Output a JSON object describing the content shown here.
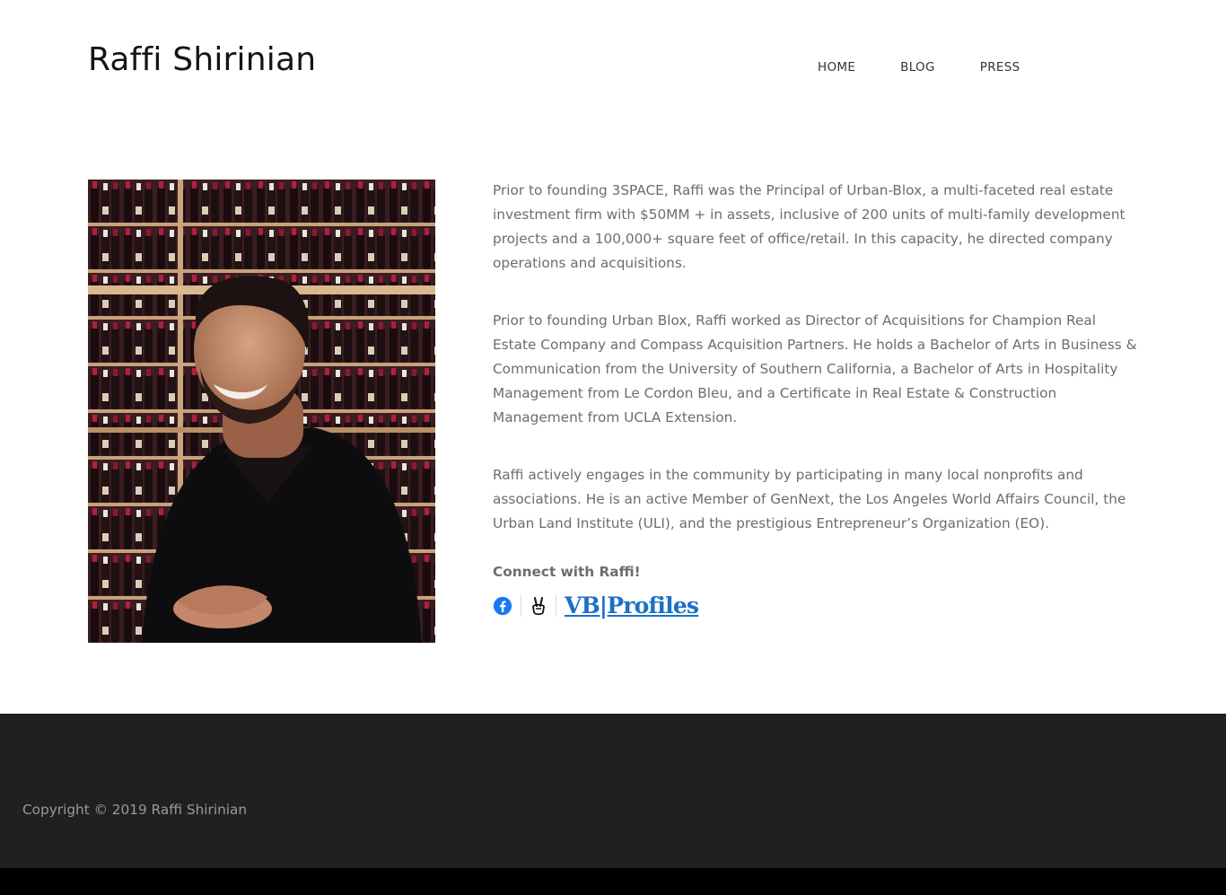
{
  "header": {
    "site_title": "Raffi Shirinian",
    "nav": [
      "HOME",
      "BLOG",
      "PRESS"
    ]
  },
  "bio": {
    "paragraphs": [
      "Prior to founding 3SPACE, Raffi was the Principal of Urban-Blox, a multi-faceted real estate investment firm with $50MM + in assets, inclusive of 200 units of multi-family development projects and a 100,000+ square feet of office/retail. In this capacity, he directed company operations and acquisitions.",
      "Prior to founding Urban Blox, Raffi worked as Director of Acquisitions for Champion Real Estate Company and Compass Acquisition Partners. He holds a Bachelor of Arts in Business & Communication from the University of Southern California, a Bachelor of Arts in Hospitality Management from Le Cordon Bleu, and a Certificate in Real Estate & Construction Management from UCLA Extension.",
      "Raffi actively engages in the community by participating in many local nonprofits and associations. He is an active Member of GenNext, the Los Angeles World Affairs Council, the Urban Land Institute (ULI), and the prestigious Entrepreneur’s Organization (EO)."
    ],
    "connect_heading": "Connect with Raffi!",
    "social": {
      "icons": [
        "facebook-icon",
        "angellist-icon"
      ],
      "vbprofiles_logo": "VB|Profiles"
    }
  },
  "footer": {
    "copyright": "Copyright © 2019 Raffi Shirinian"
  },
  "colors": {
    "facebook": "#1877f2",
    "vbprofiles": "#1d70c4",
    "footer_bg": "#1f2020",
    "body_text": "#6d6d6d"
  }
}
